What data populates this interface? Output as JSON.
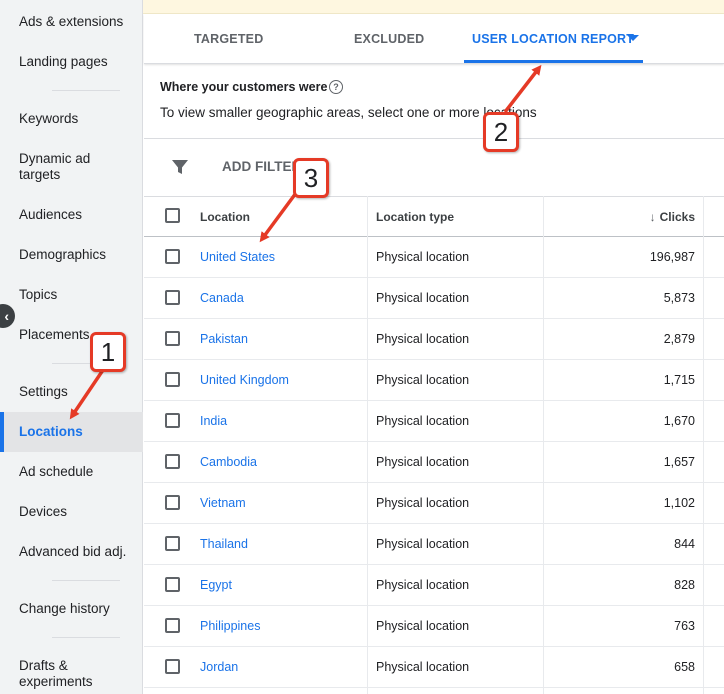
{
  "sidebar": {
    "items": [
      {
        "label": "Ads & extensions"
      },
      {
        "label": "Landing pages"
      },
      {
        "label": "Keywords"
      },
      {
        "label": "Dynamic ad targets"
      },
      {
        "label": "Audiences"
      },
      {
        "label": "Demographics"
      },
      {
        "label": "Topics"
      },
      {
        "label": "Placements"
      },
      {
        "label": "Settings"
      },
      {
        "label": "Locations"
      },
      {
        "label": "Ad schedule"
      },
      {
        "label": "Devices"
      },
      {
        "label": "Advanced bid adj."
      },
      {
        "label": "Change history"
      },
      {
        "label": "Drafts & experiments"
      }
    ],
    "active_index": 9
  },
  "tabs": [
    {
      "label": "TARGETED"
    },
    {
      "label": "EXCLUDED"
    },
    {
      "label": "USER LOCATION REPORT"
    }
  ],
  "active_tab": 2,
  "info": {
    "title": "Where your customers were",
    "help_glyph": "?",
    "text": "To view smaller geographic areas, select one or more locations"
  },
  "filter": {
    "label": "ADD FILTER"
  },
  "table": {
    "headers": {
      "location": "Location",
      "location_type": "Location type",
      "clicks": "Clicks",
      "sort_glyph": "↓"
    },
    "rows": [
      {
        "location": "United States",
        "type": "Physical location",
        "clicks": "196,987"
      },
      {
        "location": "Canada",
        "type": "Physical location",
        "clicks": "5,873"
      },
      {
        "location": "Pakistan",
        "type": "Physical location",
        "clicks": "2,879"
      },
      {
        "location": "United Kingdom",
        "type": "Physical location",
        "clicks": "1,715"
      },
      {
        "location": "India",
        "type": "Physical location",
        "clicks": "1,670"
      },
      {
        "location": "Cambodia",
        "type": "Physical location",
        "clicks": "1,657"
      },
      {
        "location": "Vietnam",
        "type": "Physical location",
        "clicks": "1,102"
      },
      {
        "location": "Thailand",
        "type": "Physical location",
        "clicks": "844"
      },
      {
        "location": "Egypt",
        "type": "Physical location",
        "clicks": "828"
      },
      {
        "location": "Philippines",
        "type": "Physical location",
        "clicks": "763"
      },
      {
        "location": "Jordan",
        "type": "Physical location",
        "clicks": "658"
      }
    ]
  },
  "annotations": {
    "badge1": "1",
    "badge2": "2",
    "badge3": "3",
    "color": "#e53a26"
  },
  "colors": {
    "accent": "#1a73e8",
    "sidebar_bg": "#f1f3f4",
    "banner_bg": "#fef7e0"
  },
  "icons": {
    "filter": "filter-icon",
    "collapse": "chevron-left-icon",
    "sort": "arrow-down-icon",
    "dropdown": "caret-down-icon",
    "help": "help-circle-icon"
  }
}
